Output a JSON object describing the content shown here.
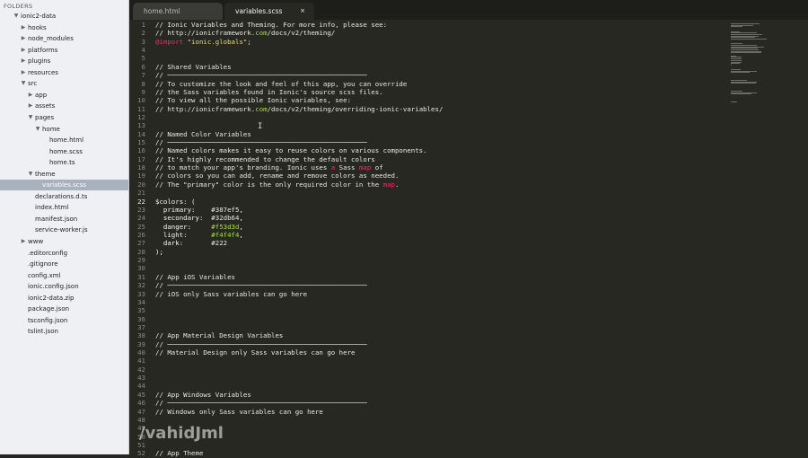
{
  "sidebar": {
    "title": "FOLDERS",
    "tree": [
      {
        "label": "ionic2-data",
        "depth": 0,
        "arrow": "▼",
        "selected": false
      },
      {
        "label": "hooks",
        "depth": 1,
        "arrow": "▶",
        "selected": false
      },
      {
        "label": "node_modules",
        "depth": 1,
        "arrow": "▶",
        "selected": false
      },
      {
        "label": "platforms",
        "depth": 1,
        "arrow": "▶",
        "selected": false
      },
      {
        "label": "plugins",
        "depth": 1,
        "arrow": "▶",
        "selected": false
      },
      {
        "label": "resources",
        "depth": 1,
        "arrow": "▶",
        "selected": false
      },
      {
        "label": "src",
        "depth": 1,
        "arrow": "▼",
        "selected": false
      },
      {
        "label": "app",
        "depth": 2,
        "arrow": "▶",
        "selected": false
      },
      {
        "label": "assets",
        "depth": 2,
        "arrow": "▶",
        "selected": false
      },
      {
        "label": "pages",
        "depth": 2,
        "arrow": "▼",
        "selected": false
      },
      {
        "label": "home",
        "depth": 3,
        "arrow": "▼",
        "selected": false
      },
      {
        "label": "home.html",
        "depth": 4,
        "arrow": "",
        "selected": false
      },
      {
        "label": "home.scss",
        "depth": 4,
        "arrow": "",
        "selected": false
      },
      {
        "label": "home.ts",
        "depth": 4,
        "arrow": "",
        "selected": false
      },
      {
        "label": "theme",
        "depth": 2,
        "arrow": "▼",
        "selected": false
      },
      {
        "label": "variables.scss",
        "depth": 3,
        "arrow": "",
        "selected": true
      },
      {
        "label": "declarations.d.ts",
        "depth": 2,
        "arrow": "",
        "selected": false
      },
      {
        "label": "index.html",
        "depth": 2,
        "arrow": "",
        "selected": false
      },
      {
        "label": "manifest.json",
        "depth": 2,
        "arrow": "",
        "selected": false
      },
      {
        "label": "service-worker.js",
        "depth": 2,
        "arrow": "",
        "selected": false
      },
      {
        "label": "www",
        "depth": 1,
        "arrow": "▶",
        "selected": false
      },
      {
        "label": ".editorconfig",
        "depth": 1,
        "arrow": "",
        "selected": false
      },
      {
        "label": ".gitignore",
        "depth": 1,
        "arrow": "",
        "selected": false
      },
      {
        "label": "config.xml",
        "depth": 1,
        "arrow": "",
        "selected": false
      },
      {
        "label": "ionic.config.json",
        "depth": 1,
        "arrow": "",
        "selected": false
      },
      {
        "label": "ionic2-data.zip",
        "depth": 1,
        "arrow": "",
        "selected": false
      },
      {
        "label": "package.json",
        "depth": 1,
        "arrow": "",
        "selected": false
      },
      {
        "label": "tsconfig.json",
        "depth": 1,
        "arrow": "",
        "selected": false
      },
      {
        "label": "tslint.json",
        "depth": 1,
        "arrow": "",
        "selected": false
      }
    ]
  },
  "tabs": [
    {
      "title": "home.html",
      "close": "×",
      "active": false
    },
    {
      "title": "variables.scss",
      "close": "×",
      "active": true
    }
  ],
  "editor": {
    "current_line": 22,
    "lines": [
      {
        "n": "1",
        "segs": [
          {
            "t": "// Ionic Variables and Theming. For more info, please see:",
            "c": "cm"
          }
        ]
      },
      {
        "n": "2",
        "segs": [
          {
            "t": "// http://ionicframework.",
            "c": "cm"
          },
          {
            "t": "com",
            "c": "hl-num"
          },
          {
            "t": "/docs/v2/theming/",
            "c": "cm"
          }
        ]
      },
      {
        "n": "3",
        "segs": [
          {
            "t": "@import",
            "c": "hl-kw"
          },
          {
            "t": " ",
            "c": "cm"
          },
          {
            "t": "\"ionic.globals\"",
            "c": "hl-str"
          },
          {
            "t": ";",
            "c": "cm"
          }
        ]
      },
      {
        "n": "4",
        "segs": []
      },
      {
        "n": "5",
        "segs": []
      },
      {
        "n": "6",
        "segs": [
          {
            "t": "// Shared Variables",
            "c": "cm"
          }
        ]
      },
      {
        "n": "7",
        "segs": [
          {
            "t": "// ──────────────────────────────────────────────────",
            "c": "cm"
          }
        ]
      },
      {
        "n": "8",
        "segs": [
          {
            "t": "// To customize the look and feel of this app, you can override",
            "c": "cm"
          }
        ]
      },
      {
        "n": "9",
        "segs": [
          {
            "t": "// the Sass variables found in Ionic's source scss files.",
            "c": "cm"
          }
        ]
      },
      {
        "n": "10",
        "segs": [
          {
            "t": "// To view all the possible Ionic variables, see:",
            "c": "cm"
          }
        ]
      },
      {
        "n": "11",
        "segs": [
          {
            "t": "// http://ionicframework.",
            "c": "cm"
          },
          {
            "t": "com",
            "c": "hl-num"
          },
          {
            "t": "/docs/v2/theming/overriding-ionic-variables/",
            "c": "cm"
          }
        ]
      },
      {
        "n": "12",
        "segs": []
      },
      {
        "n": "13",
        "segs": []
      },
      {
        "n": "14",
        "segs": [
          {
            "t": "// Named Color Variables",
            "c": "cm"
          }
        ]
      },
      {
        "n": "15",
        "segs": [
          {
            "t": "// ──────────────────────────────────────────────────",
            "c": "cm"
          }
        ]
      },
      {
        "n": "16",
        "segs": [
          {
            "t": "// Named colors makes it easy to reuse colors on various components.",
            "c": "cm"
          }
        ]
      },
      {
        "n": "17",
        "segs": [
          {
            "t": "// It's highly recommended to change the default colors",
            "c": "cm"
          }
        ]
      },
      {
        "n": "18",
        "segs": [
          {
            "t": "// to match your app's branding. Ionic uses ",
            "c": "cm"
          },
          {
            "t": "a",
            "c": "hl-kw"
          },
          {
            "t": " Sass ",
            "c": "cm"
          },
          {
            "t": "map",
            "c": "hl-kw"
          },
          {
            "t": " of",
            "c": "cm"
          }
        ]
      },
      {
        "n": "19",
        "segs": [
          {
            "t": "// colors so you can add, rename and remove colors as needed.",
            "c": "cm"
          }
        ]
      },
      {
        "n": "20",
        "segs": [
          {
            "t": "// The \"primary\" color is the only required color in the ",
            "c": "cm"
          },
          {
            "t": "map",
            "c": "hl-kw"
          },
          {
            "t": ".",
            "c": "cm"
          }
        ]
      },
      {
        "n": "21",
        "segs": []
      },
      {
        "n": "22",
        "segs": [
          {
            "t": "$colors: (",
            "c": "hl-var"
          }
        ]
      },
      {
        "n": "23",
        "segs": [
          {
            "t": "  primary:    ",
            "c": "hl-var"
          },
          {
            "t": "#387ef5",
            "c": "hl-hex"
          },
          {
            "t": ",",
            "c": "hl-var"
          }
        ]
      },
      {
        "n": "24",
        "segs": [
          {
            "t": "  secondary:  ",
            "c": "hl-var"
          },
          {
            "t": "#32db64",
            "c": "hl-hex"
          },
          {
            "t": ",",
            "c": "hl-var"
          }
        ]
      },
      {
        "n": "25",
        "segs": [
          {
            "t": "  danger:     ",
            "c": "hl-var"
          },
          {
            "t": "#f53d3d",
            "c": "hl-num"
          },
          {
            "t": ",",
            "c": "hl-var"
          }
        ]
      },
      {
        "n": "26",
        "segs": [
          {
            "t": "  light:      ",
            "c": "hl-var"
          },
          {
            "t": "#f4f4f4",
            "c": "hl-num"
          },
          {
            "t": ",",
            "c": "hl-var"
          }
        ]
      },
      {
        "n": "27",
        "segs": [
          {
            "t": "  dark:       ",
            "c": "hl-var"
          },
          {
            "t": "#222",
            "c": "hl-hex"
          }
        ]
      },
      {
        "n": "28",
        "segs": [
          {
            "t": ");",
            "c": "hl-var"
          }
        ]
      },
      {
        "n": "29",
        "segs": []
      },
      {
        "n": "30",
        "segs": []
      },
      {
        "n": "31",
        "segs": [
          {
            "t": "// App iOS Variables",
            "c": "cm"
          }
        ]
      },
      {
        "n": "32",
        "segs": [
          {
            "t": "// ──────────────────────────────────────────────────",
            "c": "cm"
          }
        ]
      },
      {
        "n": "33",
        "segs": [
          {
            "t": "// iOS only Sass variables can go here",
            "c": "cm"
          }
        ]
      },
      {
        "n": "34",
        "segs": []
      },
      {
        "n": "35",
        "segs": []
      },
      {
        "n": "36",
        "segs": []
      },
      {
        "n": "37",
        "segs": []
      },
      {
        "n": "38",
        "segs": [
          {
            "t": "// App Material Design Variables",
            "c": "cm"
          }
        ]
      },
      {
        "n": "39",
        "segs": [
          {
            "t": "// ──────────────────────────────────────────────────",
            "c": "cm"
          }
        ]
      },
      {
        "n": "40",
        "segs": [
          {
            "t": "// Material Design only Sass variables can go here",
            "c": "cm"
          }
        ]
      },
      {
        "n": "41",
        "segs": []
      },
      {
        "n": "42",
        "segs": []
      },
      {
        "n": "43",
        "segs": []
      },
      {
        "n": "44",
        "segs": []
      },
      {
        "n": "45",
        "segs": [
          {
            "t": "// App Windows Variables",
            "c": "cm"
          }
        ]
      },
      {
        "n": "46",
        "segs": [
          {
            "t": "// ──────────────────────────────────────────────────",
            "c": "cm"
          }
        ]
      },
      {
        "n": "47",
        "segs": [
          {
            "t": "// Windows only Sass variables can go here",
            "c": "cm"
          }
        ]
      },
      {
        "n": "48",
        "segs": []
      },
      {
        "n": "49",
        "segs": []
      },
      {
        "n": "50",
        "segs": []
      },
      {
        "n": "51",
        "segs": []
      },
      {
        "n": "52",
        "segs": [
          {
            "t": "// App Theme",
            "c": "cm"
          }
        ]
      }
    ]
  },
  "watermark": "/vahidJml",
  "colors": {
    "background": "#272822",
    "sidebar_bg": "#eef0f3",
    "selected_row": "#a9b1bc",
    "keyword": "#f92672",
    "string": "#e6db74",
    "number": "#a6e22e"
  }
}
